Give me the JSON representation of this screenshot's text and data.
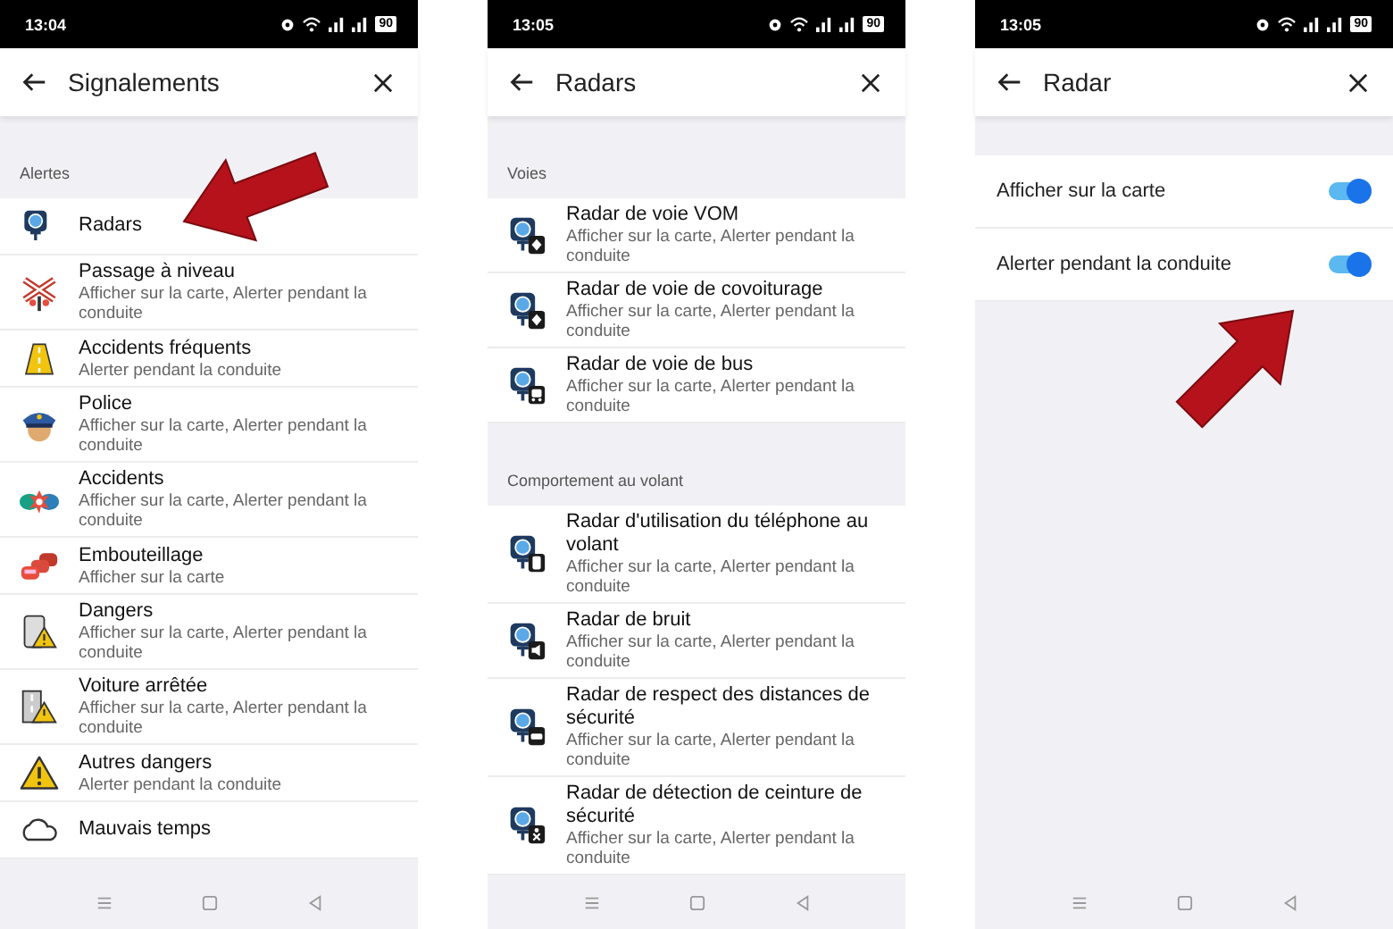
{
  "screens": [
    {
      "status_bar": {
        "time": "13:04",
        "battery": "90"
      },
      "header": {
        "title": "Signalements"
      },
      "sections": [
        {
          "heading": "Alertes",
          "items": [
            {
              "title": "Radars"
            },
            {
              "title": "Passage à niveau",
              "subtitle": "Afficher sur la carte, Alerter pendant la conduite"
            },
            {
              "title": "Accidents fréquents",
              "subtitle": "Alerter pendant la conduite"
            },
            {
              "title": "Police",
              "subtitle": "Afficher sur la carte, Alerter pendant la conduite"
            },
            {
              "title": "Accidents",
              "subtitle": "Afficher sur la carte, Alerter pendant la conduite"
            },
            {
              "title": "Embouteillage",
              "subtitle": "Afficher sur la carte"
            },
            {
              "title": "Dangers",
              "subtitle": "Afficher sur la carte, Alerter pendant la conduite"
            },
            {
              "title": "Voiture arrêtée",
              "subtitle": "Afficher sur la carte, Alerter pendant la conduite"
            },
            {
              "title": "Autres dangers",
              "subtitle": "Alerter pendant la conduite"
            },
            {
              "title": "Mauvais temps"
            }
          ]
        }
      ]
    },
    {
      "status_bar": {
        "time": "13:05",
        "battery": "90"
      },
      "header": {
        "title": "Radars"
      },
      "sections": [
        {
          "heading": "Voies",
          "items": [
            {
              "title": "Radar de voie VOM",
              "subtitle": "Afficher sur la carte, Alerter pendant la conduite"
            },
            {
              "title": "Radar de voie de covoiturage",
              "subtitle": "Afficher sur la carte, Alerter pendant la conduite"
            },
            {
              "title": "Radar de voie de bus",
              "subtitle": "Afficher sur la carte, Alerter pendant la conduite"
            }
          ]
        },
        {
          "heading": "Comportement au volant",
          "items": [
            {
              "title": "Radar d'utilisation du téléphone au volant",
              "subtitle": "Afficher sur la carte, Alerter pendant la conduite"
            },
            {
              "title": "Radar de bruit",
              "subtitle": "Afficher sur la carte, Alerter pendant la conduite"
            },
            {
              "title": "Radar de respect des distances de sécurité",
              "subtitle": "Afficher sur la carte, Alerter pendant la conduite"
            },
            {
              "title": "Radar de détection de ceinture de sécurité",
              "subtitle": "Afficher sur la carte, Alerter pendant la conduite"
            }
          ]
        }
      ]
    },
    {
      "status_bar": {
        "time": "13:05",
        "battery": "90"
      },
      "header": {
        "title": "Radar"
      },
      "settings": [
        {
          "label": "Afficher sur la carte",
          "on": true
        },
        {
          "label": "Alerter pendant la conduite",
          "on": true
        }
      ]
    }
  ]
}
